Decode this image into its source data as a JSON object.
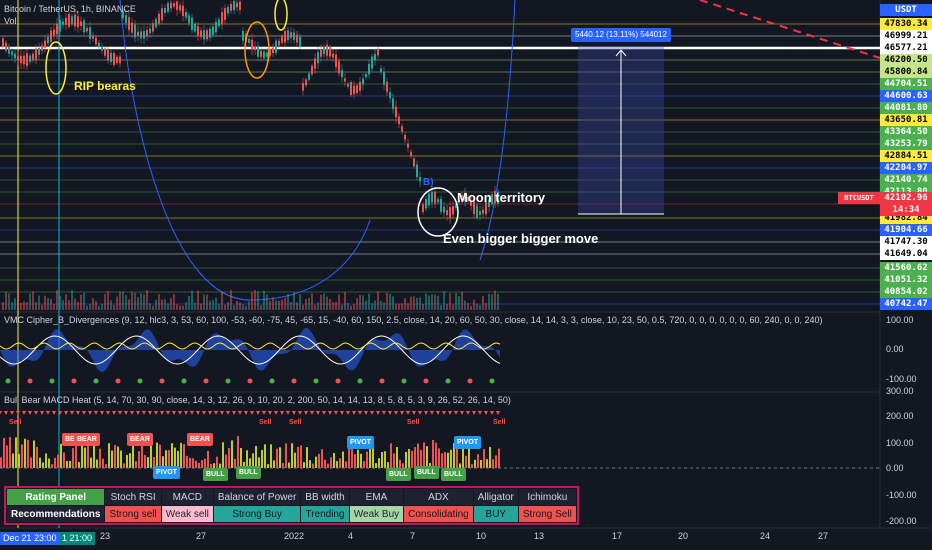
{
  "header": {
    "symbol": "Bitcoin / TetherUS, 1h, BINANCE",
    "volume_label": "Vol",
    "price_badge_top": "USDT"
  },
  "price_axis": [
    {
      "label": "47830.34",
      "bg": "#ffeb3b",
      "fg": "#000000"
    },
    {
      "label": "46999.21",
      "bg": "#ffffff",
      "fg": "#000000"
    },
    {
      "label": "46577.21",
      "bg": "#ffffff",
      "fg": "#000000"
    },
    {
      "label": "46200.50",
      "bg": "#c6e48b",
      "fg": "#000000"
    },
    {
      "label": "45800.84",
      "bg": "#c6e48b",
      "fg": "#000000"
    },
    {
      "label": "44704.51",
      "bg": "#4caf50",
      "fg": "#ffffff"
    },
    {
      "label": "44600.63",
      "bg": "#2962ff",
      "fg": "#ffffff"
    },
    {
      "label": "44081.80",
      "bg": "#4caf50",
      "fg": "#ffffff"
    },
    {
      "label": "43650.81",
      "bg": "#ffeb3b",
      "fg": "#000000"
    },
    {
      "label": "43364.50",
      "bg": "#4caf50",
      "fg": "#ffffff"
    },
    {
      "label": "43253.79",
      "bg": "#4caf50",
      "fg": "#ffffff"
    },
    {
      "label": "42884.51",
      "bg": "#ffeb3b",
      "fg": "#000000"
    },
    {
      "label": "42204.97",
      "bg": "#2962ff",
      "fg": "#ffffff"
    },
    {
      "label": "42140.74",
      "bg": "#4caf50",
      "fg": "#ffffff"
    },
    {
      "label": "42113.80",
      "bg": "#4caf50",
      "fg": "#ffffff"
    },
    {
      "label": "42102.96",
      "bg": "#f23645",
      "fg": "#ffffff"
    },
    {
      "label": "41982.84",
      "bg": "#ffeb3b",
      "fg": "#000000"
    },
    {
      "label": "41904.66",
      "bg": "#2962ff",
      "fg": "#ffffff"
    },
    {
      "label": "41747.30",
      "bg": "#ffffff",
      "fg": "#000000"
    },
    {
      "label": "41649.04",
      "bg": "#ffffff",
      "fg": "#000000"
    },
    {
      "label": "41560.62",
      "bg": "#4caf50",
      "fg": "#ffffff"
    },
    {
      "label": "41051.32",
      "bg": "#4caf50",
      "fg": "#ffffff"
    },
    {
      "label": "40854.02",
      "bg": "#4caf50",
      "fg": "#ffffff"
    },
    {
      "label": "40742.47",
      "bg": "#2962ff",
      "fg": "#ffffff"
    }
  ],
  "last_price": {
    "symbol": "BTCUSDT",
    "countdown": "14:34"
  },
  "annotations": {
    "rip": "RIP bearas",
    "moon": "Moon territory",
    "even": "Even bigger bigger move",
    "b_label": "B)"
  },
  "measure_label": "5440.12 (13.11%) 544012",
  "indicator1": {
    "title": "VMC Cipher_B_Divergences (9, 12, hlc3, 3, 53, 60, 100, -53, -60, -75, 45, -65, 15, -40, 60, 150, 2.5, close, 14, 20, 60, 50, 30, close, 14, 14, 3, 3, close, 10, 23, 50, 0.5, 720, 0, 0, 0, 0, 0, 0, 60, 240, 0, 0, 240)",
    "scale": [
      "100.00",
      "0.00",
      "-100.00"
    ]
  },
  "indicator2": {
    "title": "Bull Bear MACD Heat (5, 14, 70, 30, 90, close, 14, 3, 12, 26, 9, 10, 20, 2, 200, 50, 14, 14, 13, 8, 5, 8, 5, 3, 9, 26, 52, 26, 14, 50)",
    "scale": [
      "300.00",
      "200.00",
      "100.00",
      "0.00",
      "-100.00",
      "-200.00"
    ]
  },
  "rating_panel": {
    "headers": [
      "Rating Panel",
      "Stoch RSI",
      "MACD",
      "Balance of Power",
      "BB width",
      "EMA",
      "ADX",
      "Alligator",
      "Ichimoku"
    ],
    "values": [
      "Recommendations",
      "Strong sell",
      "Weak sell",
      "Strong Buy",
      "Trending",
      "Weak Buy",
      "Consolidating",
      "BUY",
      "Strong Sell"
    ],
    "value_colors": [
      "#d1d4dc",
      "#ef5350",
      "#f8bbd0",
      "#26a69a",
      "#26a69a",
      "#a5d6a7",
      "#ef5350",
      "#26a69a",
      "#ef5350"
    ],
    "header_colors": [
      "#43a047",
      "#1e2230",
      "#1e2230",
      "#1e2230",
      "#1e2230",
      "#1e2230",
      "#1e2230",
      "#1e2230",
      "#1e2230"
    ]
  },
  "time_axis": [
    "23",
    "27",
    "2022",
    "4",
    "7",
    "10",
    "13",
    "17",
    "20",
    "24",
    "27"
  ],
  "time_tags": [
    "Dec 21  23:00",
    "1  21:00"
  ],
  "signal_tags": {
    "sell": "Sell",
    "bear": "BEAR",
    "bull": "BULL",
    "pivot": "PIVOT"
  },
  "colors": {
    "bg": "#131722",
    "up": "#26a69a",
    "down": "#ef5350",
    "wave_blue": "#2962ff",
    "accent_yellow": "#ffeb3b"
  },
  "chart_data": {
    "type": "candlestick",
    "symbol": "BTCUSDT",
    "timeframe": "1h",
    "levels": [
      47830.34,
      46999.21,
      46577.21,
      46200.5,
      45800.84,
      44704.51,
      44600.63,
      44081.8,
      43650.81,
      43364.5,
      43253.79,
      42884.51,
      42204.97,
      42140.74,
      42113.8,
      42102.96,
      41982.84,
      41904.66,
      41747.3,
      41649.04,
      41560.62,
      41051.32,
      40854.02,
      40742.47
    ],
    "last": 42102.96,
    "measure": {
      "change": 5440.12,
      "percent": 13.11
    }
  }
}
